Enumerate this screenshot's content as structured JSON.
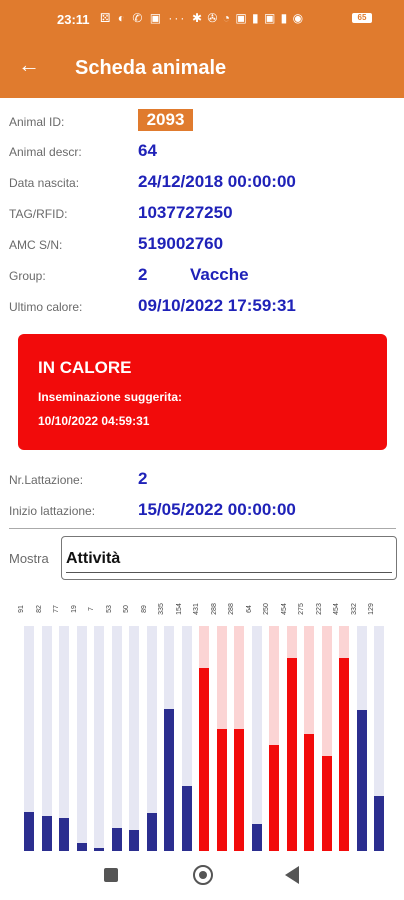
{
  "status_bar": {
    "time": "23:11",
    "left_icons": "⚄ ◐ ✆ ▣ ···",
    "right_icons": "✱ ✇ ◔ ▣ ▮ ▣ ▮ ◉",
    "battery": "65"
  },
  "app_bar": {
    "title": "Scheda animale"
  },
  "fields": {
    "animal_id_label": "Animal ID:",
    "animal_id": "2093",
    "animal_descr_label": "Animal descr:",
    "animal_descr": "64",
    "data_nascita_label": "Data nascita:",
    "data_nascita": "24/12/2018 00:00:00",
    "tag_label": "TAG/RFID:",
    "tag": "1037727250",
    "amc_label": "AMC S/N:",
    "amc": "519002760",
    "group_label": "Group:",
    "group_num": "2",
    "group_name": "Vacche",
    "ultimo_calore_label": "Ultimo calore:",
    "ultimo_calore": "09/10/2022 17:59:31"
  },
  "alert": {
    "heading": "IN CALORE",
    "subtitle": "Inseminazione suggerita:",
    "date": "10/10/2022 04:59:31"
  },
  "lactation": {
    "nr_label": "Nr.Lattazione:",
    "nr": "2",
    "inizio_label": "Inizio lattazione:",
    "inizio": "15/05/2022 00:00:00"
  },
  "mostra": {
    "label": "Mostra",
    "value": "Attività"
  },
  "colors": {
    "accent": "#e07b2e",
    "value_blue": "#1f22b8",
    "alert_red": "#f20b0b",
    "bar_blue": "#2b2e8f",
    "bar_red": "#f20b0b",
    "track_gray": "#e6e7f3",
    "track_pink": "#fbd4d4"
  },
  "chart_data": {
    "type": "bar",
    "categories": [
      "91",
      "82",
      "77",
      "19",
      "7",
      "53",
      "50",
      "89",
      "335",
      "154",
      "431",
      "288",
      "288",
      "64",
      "250",
      "454",
      "275",
      "223",
      "454",
      "332",
      "129"
    ],
    "values": [
      91,
      82,
      77,
      19,
      7,
      53,
      50,
      89,
      335,
      154,
      431,
      288,
      288,
      64,
      250,
      454,
      275,
      223,
      454,
      332,
      129
    ],
    "highlight": [
      false,
      false,
      false,
      false,
      false,
      false,
      false,
      false,
      false,
      false,
      true,
      true,
      true,
      false,
      true,
      true,
      true,
      true,
      true,
      false,
      false
    ],
    "ylim": [
      0,
      530
    ]
  }
}
